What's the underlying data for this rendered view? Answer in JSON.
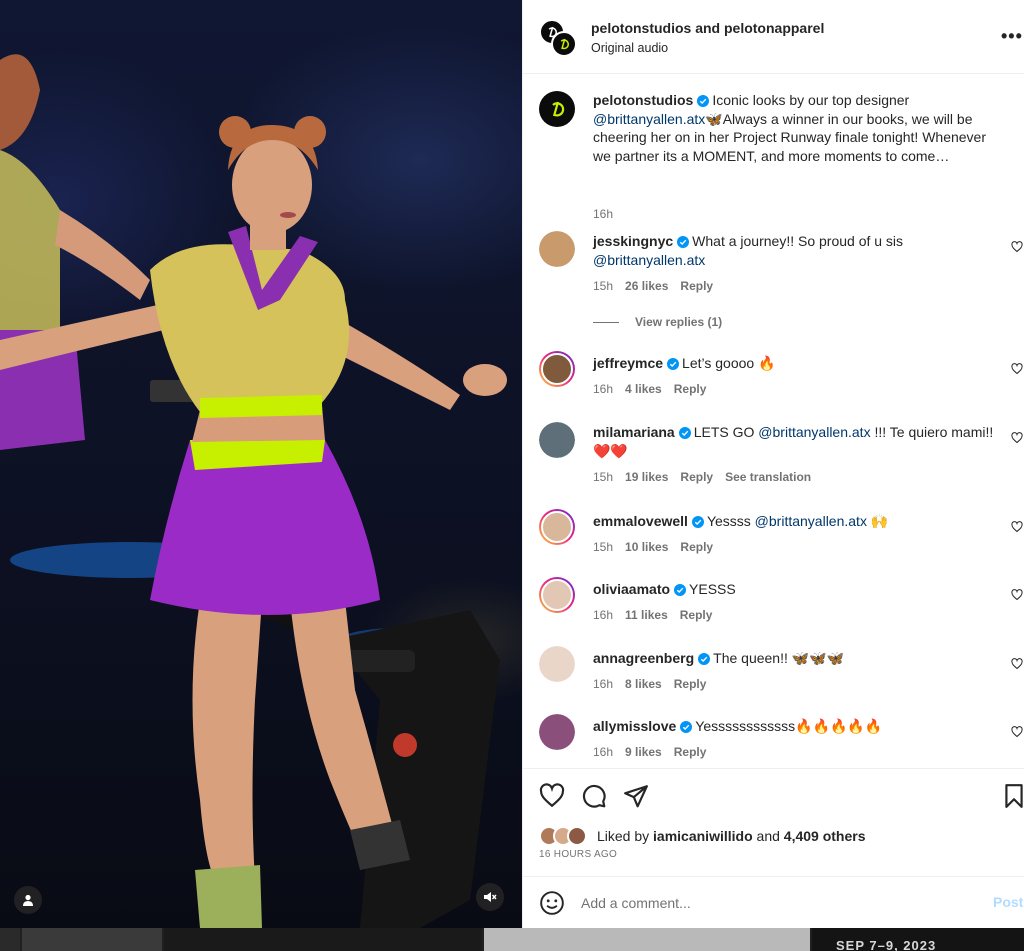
{
  "post": {
    "header": {
      "accounts_line": "pelotonstudios and pelotonapparel",
      "audio_label": "Original audio",
      "more_label": "•••"
    },
    "caption": {
      "username": "pelotonstudios",
      "text_before_mention": "Iconic looks by our top designer ",
      "mention": "@brittanyallen.atx",
      "text_after_mention": "🦋Always a winner in our books, we will be cheering her on in her Project Runway finale tonight! Whenever we partner its a MOMENT, and more moments to come…",
      "time": "16h"
    },
    "comments": [
      {
        "username": "jesskingnyc",
        "text": "What a journey!! So proud of u sis ",
        "mention": "@brittanyallen.atx",
        "text_after": "",
        "time": "15h",
        "likes": "26 likes",
        "reply": "Reply",
        "translation": "",
        "view_replies": "View replies (1)",
        "avatar_color": "#c89a6c"
      },
      {
        "username": "jeffreymce",
        "text": "Let’s goooo 🔥",
        "mention": "",
        "text_after": "",
        "time": "16h",
        "likes": "4 likes",
        "reply": "Reply",
        "translation": "",
        "view_replies": "",
        "avatar_color": "#7f5a3c"
      },
      {
        "username": "milamariana",
        "text": "LETS GO ",
        "mention": "@brittanyallen.atx",
        "text_after": " !!! Te quiero mami!!❤️❤️",
        "time": "15h",
        "likes": "19 likes",
        "reply": "Reply",
        "translation": "See translation",
        "view_replies": "",
        "avatar_color": "#5f6f7a"
      },
      {
        "username": "emmalovewell",
        "text": "Yessss ",
        "mention": "@brittanyallen.atx",
        "text_after": " 🙌",
        "time": "15h",
        "likes": "10 likes",
        "reply": "Reply",
        "translation": "",
        "view_replies": "",
        "avatar_color": "#d8b79a"
      },
      {
        "username": "oliviaamato",
        "text": "YESSS",
        "mention": "",
        "text_after": "",
        "time": "16h",
        "likes": "11 likes",
        "reply": "Reply",
        "translation": "",
        "view_replies": "",
        "avatar_color": "#e2c7b4"
      },
      {
        "username": "annagreenberg",
        "text": "The queen!! 🦋🦋🦋",
        "mention": "",
        "text_after": "",
        "time": "16h",
        "likes": "8 likes",
        "reply": "Reply",
        "translation": "",
        "view_replies": "",
        "avatar_color": "#e9d6c8"
      },
      {
        "username": "allymisslove",
        "text": "Yessssssssssss🔥🔥🔥🔥🔥",
        "mention": "",
        "text_after": "",
        "time": "16h",
        "likes": "9 likes",
        "reply": "Reply",
        "translation": "",
        "view_replies": "",
        "avatar_color": "#8a4f7a"
      }
    ],
    "likes": {
      "prefix": "Liked by ",
      "first_liker": "iamicaniwillido",
      "middle": " and ",
      "others": "4,409 others"
    },
    "posted_ago": "16 HOURS AGO",
    "add_comment": {
      "placeholder": "Add a comment...",
      "post_label": "Post"
    }
  },
  "bottom_strip": {
    "date_text": "SEP 7–9, 2023"
  },
  "colors": {
    "accent_link": "#00376b",
    "verified": "#0095f6",
    "muted": "#737373",
    "brand_green": "#c7f000"
  },
  "icons": [
    "verified-badge-icon",
    "heart-icon",
    "comment-icon",
    "share-icon",
    "bookmark-icon",
    "emoji-icon",
    "user-tag-icon",
    "mute-icon",
    "more-icon",
    "peloton-logo-icon"
  ]
}
